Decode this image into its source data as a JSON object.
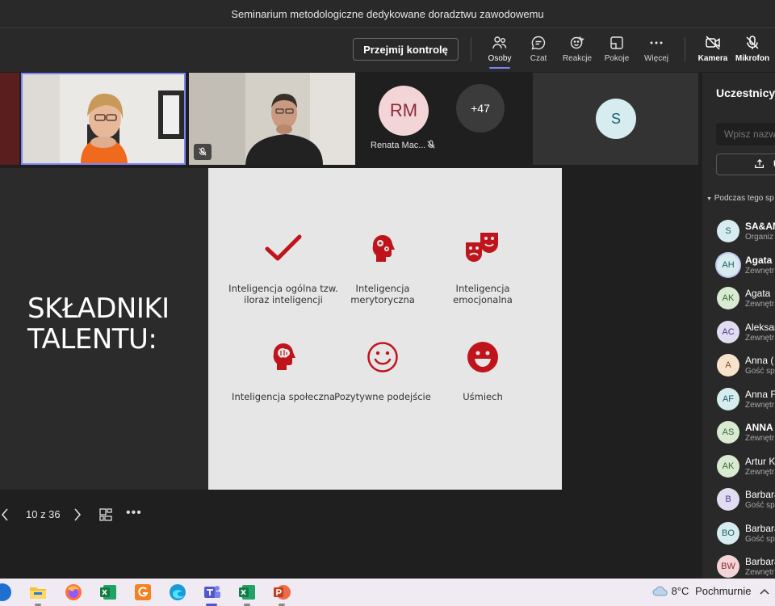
{
  "window": {
    "title": "Seminarium metodologiczne dedykowane doradztwu zawodowemu"
  },
  "toolbar": {
    "take_control_label": "Przejmij kontrolę",
    "items": [
      {
        "label": "Osoby",
        "icon": "people-icon"
      },
      {
        "label": "Czat",
        "icon": "chat-icon"
      },
      {
        "label": "Reakcje",
        "icon": "reactions-icon"
      },
      {
        "label": "Pokoje",
        "icon": "rooms-icon"
      },
      {
        "label": "Więcej",
        "icon": "more-icon"
      },
      {
        "label": "Kamera",
        "icon": "camera-off-icon"
      },
      {
        "label": "Mikrofon",
        "icon": "mic-off-icon"
      }
    ]
  },
  "video_strip": {
    "rm_initials": "RM",
    "rm_name": "Renata Mac...",
    "more_participants": "+47",
    "s_initial": "S"
  },
  "slide": {
    "title": "SKŁADNIKI TALENTU:",
    "features": [
      {
        "label": "Inteligencja ogólna tzw. iloraz inteligencji",
        "icon": "checkmark-icon"
      },
      {
        "label": "Inteligencja merytoryczna",
        "icon": "head-gears-icon"
      },
      {
        "label": "Inteligencja emocjonalna",
        "icon": "theatre-masks-icon"
      },
      {
        "label": "Inteligencja społeczna",
        "icon": "head-brain-icon"
      },
      {
        "label": "Pozytywne podejście",
        "icon": "smiley-outline-icon"
      },
      {
        "label": "Uśmiech",
        "icon": "smiley-filled-icon"
      }
    ],
    "accent_color": "#c0141c"
  },
  "slide_nav": {
    "counter": "10 z 36"
  },
  "panel": {
    "title": "Uczestnicy",
    "search_placeholder": "Wpisz nazw",
    "share_label": "U",
    "section_header": "Podczas tego sp",
    "participants": [
      {
        "initials": "S",
        "name": "SA&AM",
        "sub": "Organiz",
        "bg": "#d6ecef",
        "fg": "#1e5f6a"
      },
      {
        "initials": "AH",
        "name": "Agata",
        "sub": "Zewnętr",
        "bg": "#d6ecef",
        "fg": "#1e5f6a"
      },
      {
        "initials": "AK",
        "name": "Agata",
        "sub": "Zewnętr",
        "bg": "#d9ead3",
        "fg": "#3b6b2d"
      },
      {
        "initials": "AC",
        "name": "Aleksar",
        "sub": "Zewnętr",
        "bg": "#e2dcf2",
        "fg": "#4b3b8a"
      },
      {
        "initials": "A",
        "name": "Anna (",
        "sub": "Gość spo",
        "bg": "#f8e3cc",
        "fg": "#8a4b12"
      },
      {
        "initials": "AF",
        "name": "Anna F",
        "sub": "Zewnętr",
        "bg": "#d6ecef",
        "fg": "#1e5f6a"
      },
      {
        "initials": "AS",
        "name": "ANNA",
        "sub": "Zewnętr",
        "bg": "#d9ead3",
        "fg": "#3b6b2d"
      },
      {
        "initials": "AK",
        "name": "Artur K",
        "sub": "Zewnętr",
        "bg": "#d9ead3",
        "fg": "#3b6b2d"
      },
      {
        "initials": "B",
        "name": "Barbara",
        "sub": "Gość spo",
        "bg": "#e2dcf2",
        "fg": "#4b3b8a"
      },
      {
        "initials": "BO",
        "name": "Barbara",
        "sub": "Gość spo",
        "bg": "#d6ecef",
        "fg": "#1e5f6a"
      },
      {
        "initials": "BW",
        "name": "Barbara",
        "sub": "Zewnętr",
        "bg": "#f3d5d7",
        "fg": "#8c2b35"
      }
    ]
  },
  "taskbar": {
    "weather_temp": "8°C",
    "weather_desc": "Pochmurnie"
  }
}
